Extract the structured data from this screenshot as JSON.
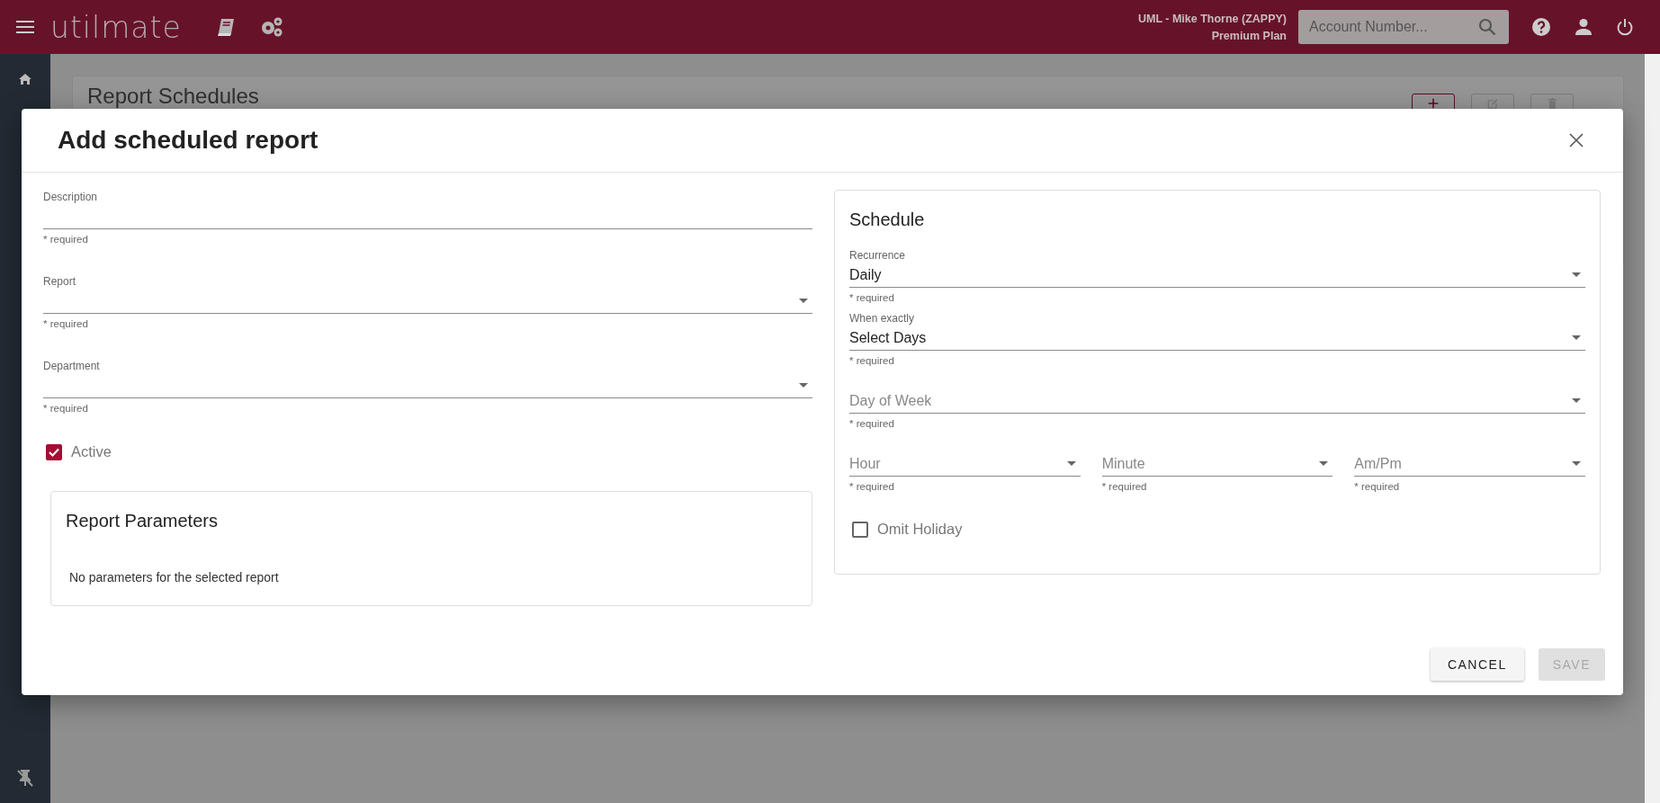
{
  "app_bar": {
    "logo": "utilmate",
    "user": "UML - Mike Thorne (ZAPPY)",
    "plan": "Premium Plan",
    "search": {
      "placeholder": "Account Number..."
    }
  },
  "page": {
    "title": "Report Schedules"
  },
  "dialog": {
    "title": "Add scheduled report",
    "fields": [
      {
        "kind": "text",
        "label": "Description",
        "hint": "* required"
      },
      {
        "kind": "select",
        "label": "Report",
        "hint": "* required"
      },
      {
        "kind": "select",
        "label": "Department",
        "hint": "* required"
      }
    ],
    "active": {
      "label": "Active",
      "checked": true
    },
    "parameters": {
      "title": "Report Parameters",
      "message": "No parameters for the selected report"
    },
    "schedule": {
      "title": "Schedule",
      "fields": [
        {
          "kind": "select",
          "label": "Recurrence",
          "value": "Daily",
          "hint": "* required"
        },
        {
          "kind": "select",
          "label": "When exactly",
          "value": "Select Days",
          "hint": "* required"
        },
        {
          "kind": "select",
          "placeholder": "Day of Week",
          "hint": "* required"
        }
      ],
      "time_fields": [
        {
          "kind": "select",
          "placeholder": "Hour",
          "hint": "* required"
        },
        {
          "kind": "select",
          "placeholder": "Minute",
          "hint": "* required"
        },
        {
          "kind": "select",
          "placeholder": "Am/Pm",
          "hint": "* required"
        }
      ],
      "omit_holiday": {
        "label": "Omit Holiday",
        "checked": false
      }
    },
    "buttons": [
      {
        "label": "CANCEL",
        "disabled": false
      },
      {
        "label": "SAVE",
        "disabled": true
      }
    ]
  }
}
